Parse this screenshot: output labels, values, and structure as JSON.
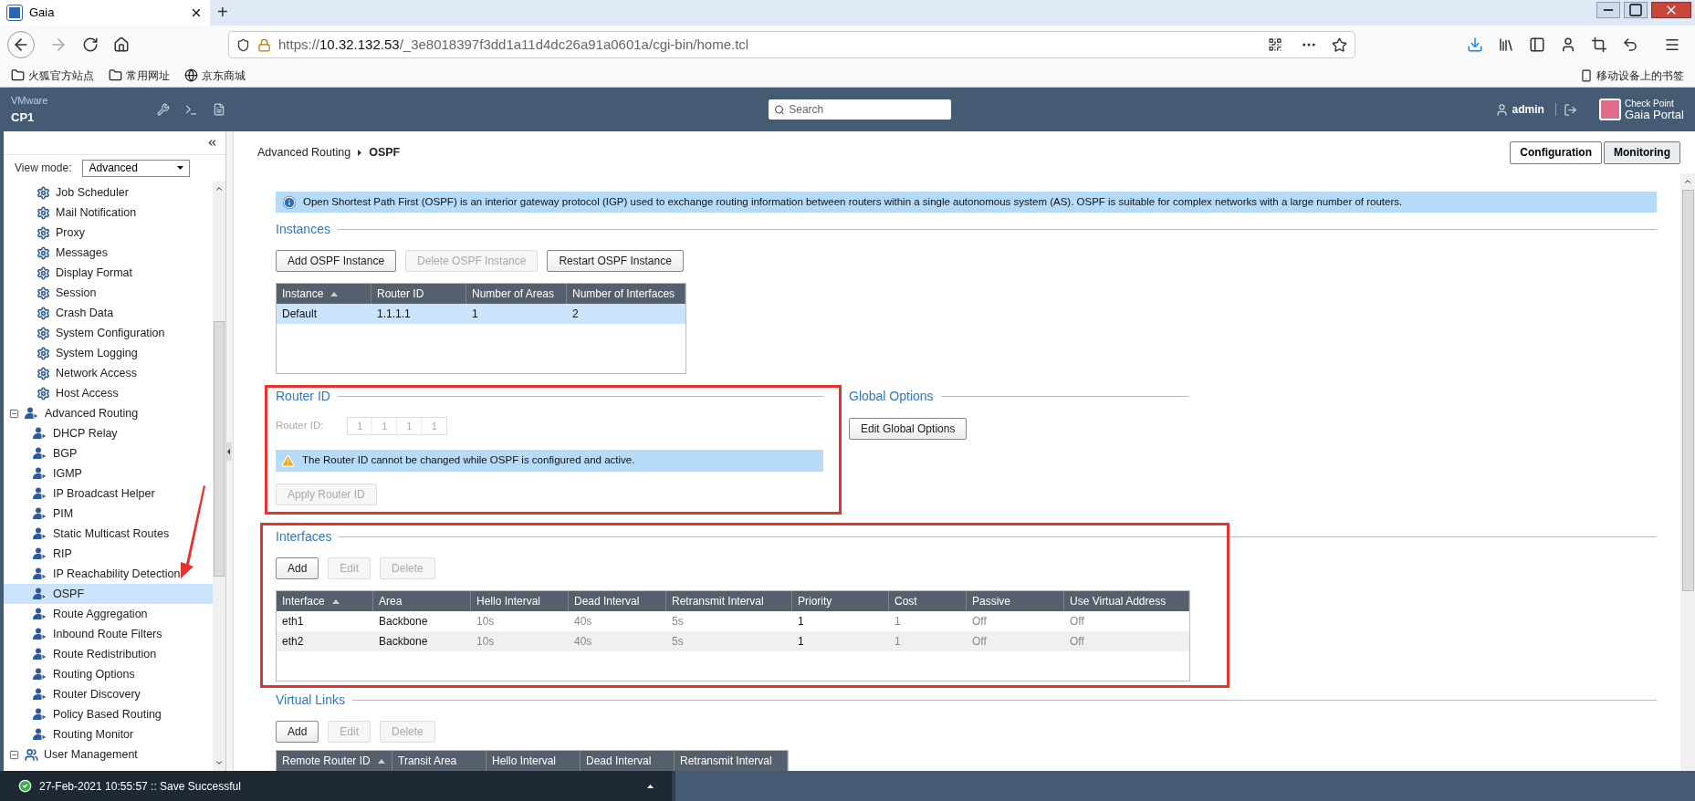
{
  "browser": {
    "tab": {
      "title": "Gaia",
      "selected": true
    },
    "new_tab": "+",
    "url": {
      "scheme": "https://",
      "host": "10.32.132.53",
      "path": "/_3e8018397f3dd1a11d4dc26a91a0601a/cgi-bin/home.tcl"
    },
    "bookmarks": [
      "火狐官方站点",
      "常用网址",
      "京东商城"
    ],
    "mobile_bookmarks": "移动设备上的书签"
  },
  "header": {
    "vendor": "VMware",
    "host": "CP1",
    "search": {
      "placeholder": "Search"
    },
    "user": "admin",
    "logo": {
      "line1": "Check Point",
      "line2": "Gaia Portal"
    }
  },
  "sidebar": {
    "view_mode": {
      "label": "View mode:",
      "value": "Advanced"
    },
    "items": [
      {
        "label": "Job Scheduler",
        "kind": "gear",
        "selected": false
      },
      {
        "label": "Mail Notification",
        "kind": "gear",
        "selected": false
      },
      {
        "label": "Proxy",
        "kind": "gear",
        "selected": false
      },
      {
        "label": "Messages",
        "kind": "gear",
        "selected": false
      },
      {
        "label": "Display Format",
        "kind": "gear",
        "selected": false
      },
      {
        "label": "Session",
        "kind": "gear",
        "selected": false
      },
      {
        "label": "Crash Data",
        "kind": "gear",
        "selected": false
      },
      {
        "label": "System Configuration",
        "kind": "gear",
        "selected": false
      },
      {
        "label": "System Logging",
        "kind": "gear",
        "selected": false
      },
      {
        "label": "Network Access",
        "kind": "gear",
        "selected": false
      },
      {
        "label": "Host Access",
        "kind": "gear",
        "selected": false
      },
      {
        "label": "Advanced Routing",
        "kind": "routing",
        "selected": false,
        "expanded": true,
        "children": [
          {
            "label": "DHCP Relay",
            "kind": "routing",
            "selected": false
          },
          {
            "label": "BGP",
            "kind": "routing",
            "selected": false
          },
          {
            "label": "IGMP",
            "kind": "routing",
            "selected": false
          },
          {
            "label": "IP Broadcast Helper",
            "kind": "routing",
            "selected": false
          },
          {
            "label": "PIM",
            "kind": "routing",
            "selected": false
          },
          {
            "label": "Static Multicast Routes",
            "kind": "routing",
            "selected": false
          },
          {
            "label": "RIP",
            "kind": "routing",
            "selected": false
          },
          {
            "label": "IP Reachability Detection",
            "kind": "routing",
            "selected": false
          },
          {
            "label": "OSPF",
            "kind": "routing",
            "selected": true
          },
          {
            "label": "Route Aggregation",
            "kind": "routing",
            "selected": false
          },
          {
            "label": "Inbound Route Filters",
            "kind": "routing",
            "selected": false
          },
          {
            "label": "Route Redistribution",
            "kind": "routing",
            "selected": false
          },
          {
            "label": "Routing Options",
            "kind": "routing",
            "selected": false
          },
          {
            "label": "Router Discovery",
            "kind": "routing",
            "selected": false
          },
          {
            "label": "Policy Based Routing",
            "kind": "routing",
            "selected": false
          },
          {
            "label": "Routing Monitor",
            "kind": "routing",
            "selected": false
          }
        ]
      },
      {
        "label": "User Management",
        "kind": "users",
        "selected": false,
        "expanded": true
      }
    ]
  },
  "breadcrumb": [
    "Advanced Routing",
    "OSPF"
  ],
  "view_tabs": [
    {
      "label": "Configuration",
      "selected": true
    },
    {
      "label": "Monitoring",
      "selected": false
    }
  ],
  "info": "Open Shortest Path First (OSPF) is an interior gateway protocol (IGP) used to exchange routing information between routers within a single autonomous system (AS). OSPF is suitable for complex networks with a large number of routers.",
  "instances": {
    "title": "Instances",
    "buttons": [
      {
        "label": "Add OSPF Instance",
        "disabled": false
      },
      {
        "label": "Delete OSPF Instance",
        "disabled": true
      },
      {
        "label": "Restart OSPF Instance",
        "disabled": false
      }
    ],
    "columns": [
      {
        "label": "Instance",
        "sorted": true
      },
      {
        "label": "Router ID"
      },
      {
        "label": "Number of Areas"
      },
      {
        "label": "Number of Interfaces"
      }
    ],
    "rows": [
      {
        "cells": [
          "Default",
          "1.1.1.1",
          "1",
          "2"
        ],
        "selected": true
      }
    ]
  },
  "router_id": {
    "title": "Router ID",
    "highlighted": true,
    "label": "Router ID:",
    "octets": [
      "1",
      "1",
      "1",
      "1"
    ],
    "disabled": true,
    "warning": "The Router ID cannot be changed while OSPF is configured and active.",
    "button": {
      "label": "Apply Router ID",
      "disabled": true
    }
  },
  "global_options": {
    "title": "Global Options",
    "button": {
      "label": "Edit Global Options",
      "disabled": false
    }
  },
  "interfaces": {
    "title": "Interfaces",
    "highlighted": true,
    "buttons": [
      {
        "label": "Add",
        "disabled": false
      },
      {
        "label": "Edit",
        "disabled": true
      },
      {
        "label": "Delete",
        "disabled": true
      }
    ],
    "columns": [
      {
        "label": "Interface",
        "sorted": true,
        "muted": false
      },
      {
        "label": "Area",
        "muted": false
      },
      {
        "label": "Hello Interval",
        "muted": true
      },
      {
        "label": "Dead Interval",
        "muted": true
      },
      {
        "label": "Retransmit Interval",
        "muted": true
      },
      {
        "label": "Priority",
        "muted": false
      },
      {
        "label": "Cost",
        "muted": true
      },
      {
        "label": "Passive",
        "muted": true
      },
      {
        "label": "Use Virtual Address",
        "muted": true
      }
    ],
    "rows": [
      {
        "cells": [
          "eth1",
          "Backbone",
          "10s",
          "40s",
          "5s",
          "1",
          "1",
          "Off",
          "Off"
        ],
        "selected": false
      },
      {
        "cells": [
          "eth2",
          "Backbone",
          "10s",
          "40s",
          "5s",
          "1",
          "1",
          "Off",
          "Off"
        ],
        "selected": false
      }
    ]
  },
  "virtual_links": {
    "title": "Virtual Links",
    "buttons": [
      {
        "label": "Add",
        "disabled": false
      },
      {
        "label": "Edit",
        "disabled": true
      },
      {
        "label": "Delete",
        "disabled": true
      }
    ],
    "columns": [
      {
        "label": "Remote Router ID",
        "sorted": true
      },
      {
        "label": "Transit Area"
      },
      {
        "label": "Hello Interval"
      },
      {
        "label": "Dead Interval"
      },
      {
        "label": "Retransmit Interval"
      }
    ]
  },
  "status_bar": {
    "message": "27-Feb-2021 10:55:57 :: Save Successful"
  }
}
